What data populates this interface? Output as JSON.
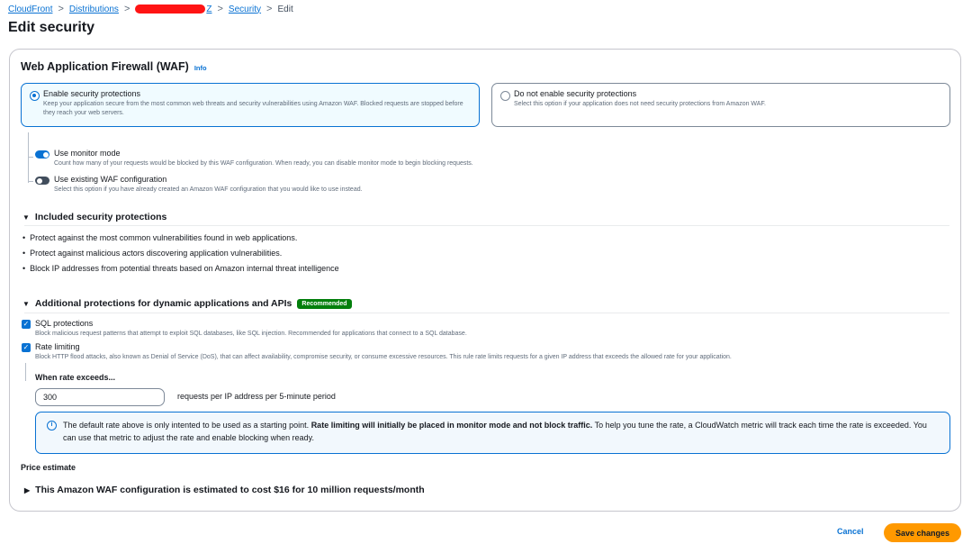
{
  "breadcrumb": {
    "items": [
      "CloudFront",
      "Distributions",
      "Z",
      "Security"
    ],
    "current": "Edit",
    "separator": ">"
  },
  "page": {
    "title": "Edit security"
  },
  "waf": {
    "heading": "Web Application Firewall (WAF)",
    "info": "Info",
    "options": [
      {
        "title": "Enable security protections",
        "desc": "Keep your application secure from the most common web threats and security vulnerabilities using Amazon WAF. Blocked requests are stopped before they reach your web servers.",
        "selected": true
      },
      {
        "title": "Do not enable security protections",
        "desc": "Select this option if your application does not need security protections from Amazon WAF.",
        "selected": false
      }
    ],
    "toggles": [
      {
        "label": "Use monitor mode",
        "desc": "Count how many of your requests would be blocked by this WAF configuration. When ready, you can disable monitor mode to begin blocking requests.",
        "on": true
      },
      {
        "label": "Use existing WAF configuration",
        "desc": "Select this option if you have already created an Amazon WAF configuration that you would like to use instead.",
        "on": false
      }
    ]
  },
  "included": {
    "heading": "Included security protections",
    "bullets": [
      "Protect against the most common vulnerabilities found in web applications.",
      "Protect against malicious actors discovering application vulnerabilities.",
      "Block IP addresses from potential threats based on Amazon internal threat intelligence"
    ]
  },
  "additional": {
    "heading": "Additional protections for dynamic applications and APIs",
    "badge": "Recommended",
    "checks": [
      {
        "label": "SQL protections",
        "desc": "Block malicious request patterns that attempt to exploit SQL databases, like SQL injection. Recommended for applications that connect to a SQL database.",
        "checked": true
      },
      {
        "label": "Rate limiting",
        "desc": "Block HTTP flood attacks, also known as Denial of Service (DoS), that can affect availability, compromise security, or consume excessive resources. This rule rate limits requests for a given IP address that exceeds the allowed rate for your application.",
        "checked": true
      }
    ],
    "rate": {
      "label": "When rate exceeds...",
      "value": "300",
      "suffix": "requests per IP address per 5-minute period"
    },
    "alert": {
      "text1": "The default rate above is only intented to be used as a starting point. ",
      "bold": "Rate limiting will initially be placed in monitor mode and not block traffic.",
      "text2": " To help you tune the rate, a CloudWatch metric will track each time the rate is exceeded. You can use that metric to adjust the rate and enable blocking when ready."
    }
  },
  "price": {
    "label": "Price estimate",
    "estimate": "This Amazon WAF configuration is estimated to cost $16 for 10 million requests/month"
  },
  "footer": {
    "cancel": "Cancel",
    "save": "Save changes"
  },
  "colors": {
    "accent": "#0972d3",
    "primary_button": "#ff9900",
    "badge": "#037f0c",
    "redaction": "#ff1414"
  }
}
